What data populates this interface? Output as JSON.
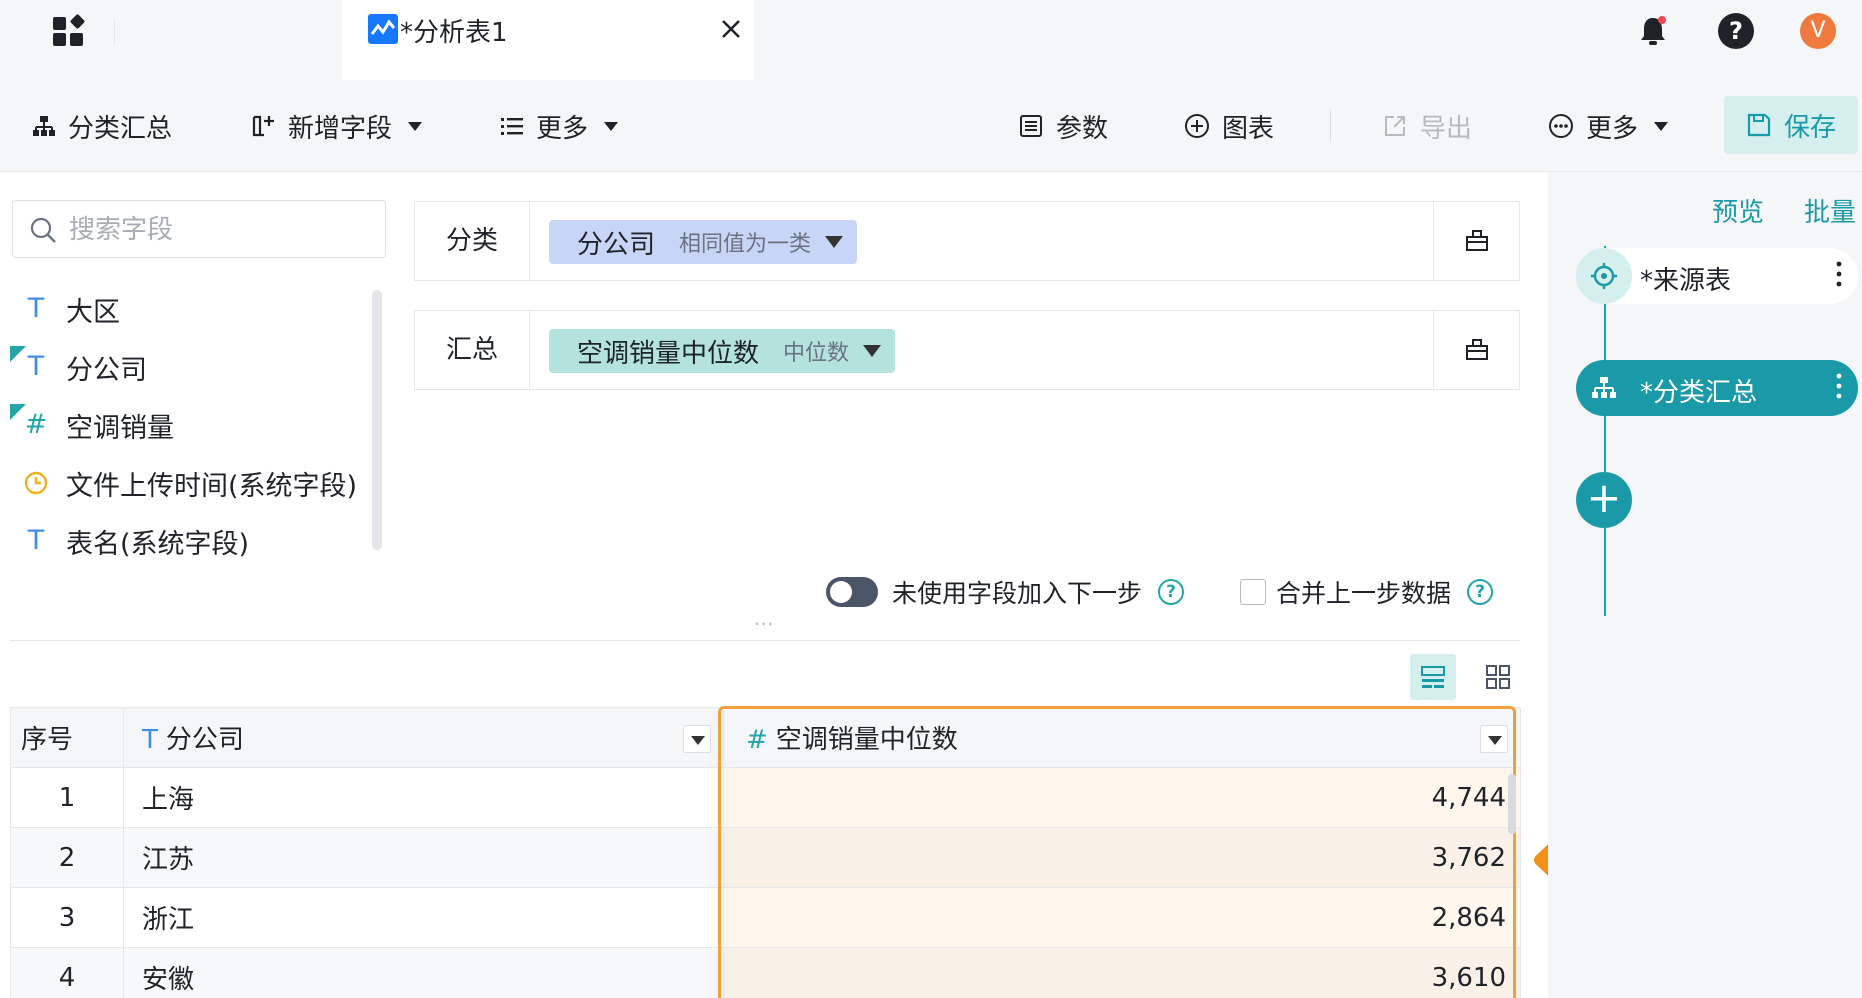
{
  "tabbar": {
    "tab_title": "*分析表1",
    "avatar_letter": "V"
  },
  "toolbar": {
    "group_summary": "分类汇总",
    "add_field": "新增字段",
    "more_left": "更多",
    "params": "参数",
    "chart": "图表",
    "export": "导出",
    "more_right": "更多",
    "save": "保存"
  },
  "field_panel": {
    "search_placeholder": "搜索字段",
    "fields": [
      {
        "label": "大区",
        "type": "text"
      },
      {
        "label": "分公司",
        "type": "text"
      },
      {
        "label": "空调销量",
        "type": "number"
      },
      {
        "label": "文件上传时间(系统字段)",
        "type": "datetime"
      },
      {
        "label": "表名(系统字段)",
        "type": "text"
      }
    ]
  },
  "config": {
    "category_label": "分类",
    "category_chip": "分公司",
    "category_chip_sub": "相同值为一类",
    "summary_label": "汇总",
    "summary_chip": "空调销量中位数",
    "summary_chip_sub": "中位数",
    "unused_toggle_label": "未使用字段加入下一步",
    "merge_label": "合并上一步数据"
  },
  "table": {
    "headers": {
      "index": "序号",
      "branch": "分公司",
      "median": "空调销量中位数"
    },
    "rows": [
      {
        "index": "1",
        "branch": "上海",
        "median": "4,744"
      },
      {
        "index": "2",
        "branch": "江苏",
        "median": "3,762"
      },
      {
        "index": "3",
        "branch": "浙江",
        "median": "2,864"
      },
      {
        "index": "4",
        "branch": "安徽",
        "median": "3,610"
      }
    ]
  },
  "steps_panel": {
    "preview": "预览",
    "batch": "批量",
    "steps": [
      {
        "label": "*来源表",
        "active": false
      },
      {
        "label": "*分类汇总",
        "active": true
      }
    ]
  },
  "colors": {
    "accent": "#1a9aa8",
    "highlight": "#f0a23a",
    "tab_icon": "#1677ff",
    "avatar": "#f07a3e"
  }
}
